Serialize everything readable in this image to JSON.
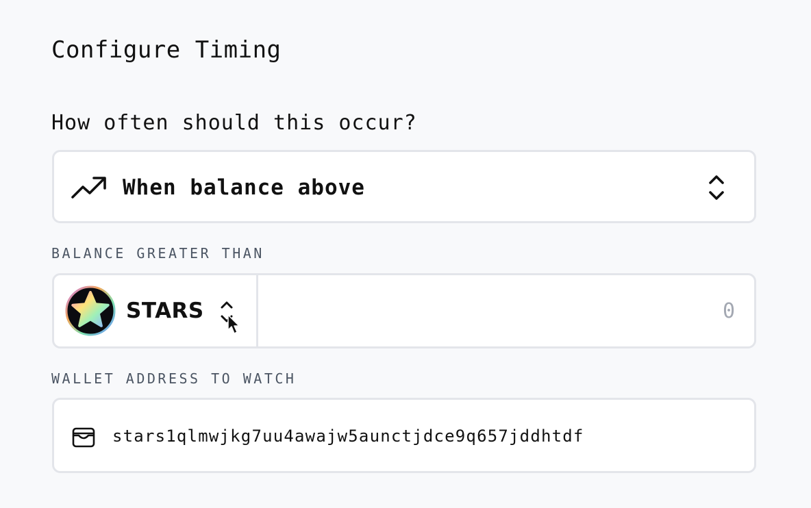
{
  "page_title": "Configure Timing",
  "frequency": {
    "question": "How often should this occur?",
    "selected_label": "When balance above",
    "icon": "trending-up-icon",
    "chevron_icon": "chevrons-up-down-icon"
  },
  "balance": {
    "label": "BALANCE GREATER THAN",
    "token": {
      "name": "STARS",
      "icon": "stars-token-logo"
    },
    "amount_placeholder": "0"
  },
  "wallet": {
    "label": "WALLET ADDRESS TO WATCH",
    "address": "stars1qlmwjkg7uu4awajw5aunctjdce9q657jddhtdf",
    "icon": "wallet-icon"
  },
  "colors": {
    "background": "#f8f9fb",
    "card": "#ffffff",
    "border": "#e3e5ea",
    "text": "#111111",
    "muted_label": "#4b5563",
    "placeholder": "#a3a8b2"
  }
}
